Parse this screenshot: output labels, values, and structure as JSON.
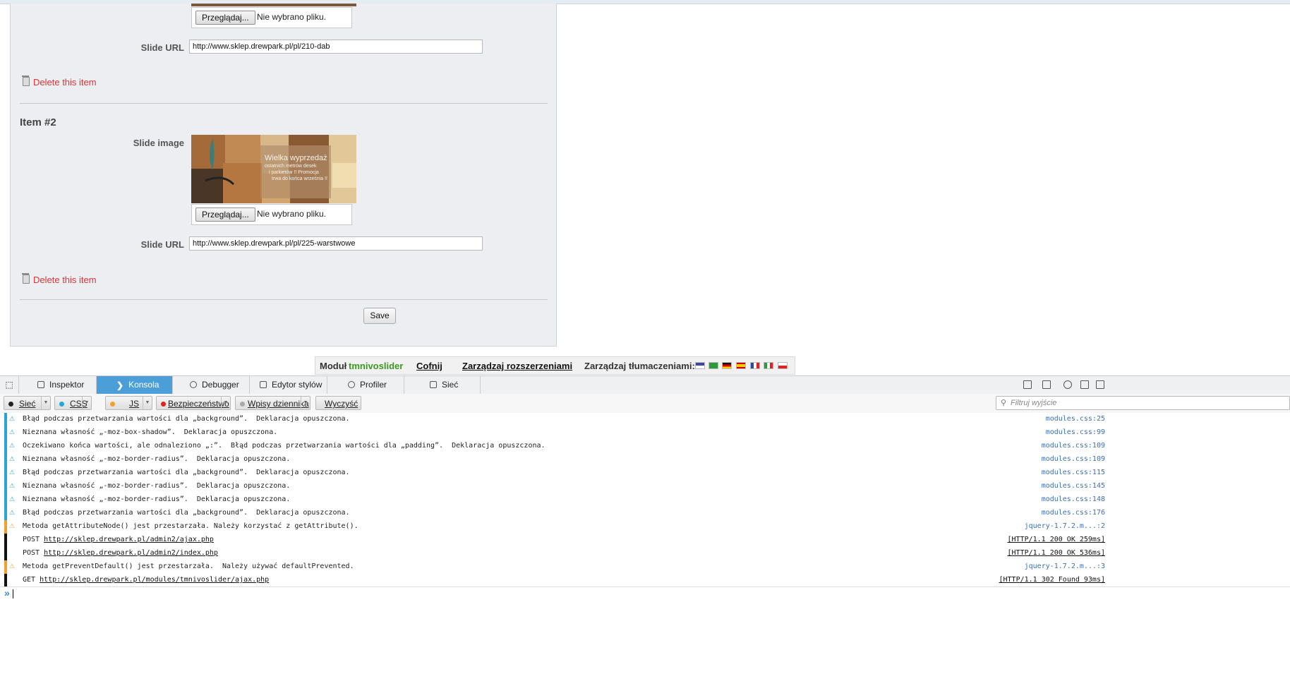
{
  "form": {
    "item1": {
      "file_button": "Przeglądaj...",
      "file_status": "Nie wybrano pliku.",
      "url_label": "Slide URL",
      "url_value": "http://www.sklep.drewpark.pl/pl/210-dab",
      "delete_label": "Delete this item"
    },
    "item2": {
      "heading": "Item #2",
      "image_label": "Slide image",
      "image_caption": "Wielka wyprzedaż ostatnich metrów desek i parkietów !! Promocja trwa do końca września !!",
      "file_button": "Przeglądaj...",
      "file_status": "Nie wybrano pliku.",
      "url_label": "Slide URL",
      "url_value": "http://www.sklep.drewpark.pl/pl/225-warstwowe",
      "delete_label": "Delete this item"
    },
    "save_label": "Save"
  },
  "module_bar": {
    "module_prefix": "Moduł",
    "module_name": "tmnivoslider",
    "back": "Cofnij",
    "manage_extensions": "Zarządzaj rozszerzeniami",
    "manage_translations": "Zarządzaj tłumaczeniami:"
  },
  "devtools": {
    "tabs": [
      "Inspektor",
      "Konsola",
      "Debugger",
      "Edytor stylów",
      "Profiler",
      "Sieć"
    ],
    "filters": {
      "net": "Sieć",
      "css": "CSS",
      "js": "JS",
      "security": "Bezpieczeństwo",
      "log": "Wpisy dziennika",
      "clear": "Wyczyść"
    },
    "filter_placeholder": "Filtruj wyjście"
  },
  "console": [
    {
      "type": "css",
      "msg": "Błąd podczas przetwarzania wartości dla „background”.  Deklaracja opuszczona.",
      "src": "modules.css:25"
    },
    {
      "type": "css",
      "msg": "Nieznana własność „-moz-box-shadow”.  Deklaracja opuszczona.",
      "src": "modules.css:99"
    },
    {
      "type": "css",
      "msg": "Oczekiwano końca wartości, ale odnaleziono „:”.  Błąd podczas przetwarzania wartości dla „padding”.  Deklaracja opuszczona.",
      "src": "modules.css:109"
    },
    {
      "type": "css",
      "msg": "Nieznana własność „-moz-border-radius”.  Deklaracja opuszczona.",
      "src": "modules.css:109"
    },
    {
      "type": "css",
      "msg": "Błąd podczas przetwarzania wartości dla „background”.  Deklaracja opuszczona.",
      "src": "modules.css:115"
    },
    {
      "type": "css",
      "msg": "Nieznana własność „-moz-border-radius”.  Deklaracja opuszczona.",
      "src": "modules.css:145"
    },
    {
      "type": "css",
      "msg": "Nieznana własność „-moz-border-radius”.  Deklaracja opuszczona.",
      "src": "modules.css:148"
    },
    {
      "type": "css",
      "msg": "Błąd podczas przetwarzania wartości dla „background”.  Deklaracja opuszczona.",
      "src": "modules.css:176"
    },
    {
      "type": "js",
      "msg": "Metoda getAttributeNode() jest przestarzała. Należy korzystać z getAttribute().",
      "src": "jquery-1.7.2.m...:2"
    },
    {
      "type": "net",
      "method": "POST",
      "url": "http://sklep.drewpark.pl/admin2/ajax.php",
      "src": "[HTTP/1.1 200 OK 259ms]"
    },
    {
      "type": "net",
      "method": "POST",
      "url": "http://sklep.drewpark.pl/admin2/index.php",
      "src": "[HTTP/1.1 200 OK 536ms]"
    },
    {
      "type": "js",
      "msg": "Metoda getPreventDefault() jest przestarzała.  Należy używać defaultPrevented.",
      "src": "jquery-1.7.2.m...:3"
    },
    {
      "type": "net",
      "method": "GET",
      "url": "http://sklep.drewpark.pl/modules/tmnivoslider/ajax.php",
      "src": "[HTTP/1.1 302 Found 93ms]"
    }
  ],
  "colors": {
    "css": "#29a3d9",
    "js": "#f0a030",
    "net": "#111111",
    "active_tab": "#4c9ed9",
    "delete": "#dd3333",
    "module_name": "#3a9a1f"
  }
}
